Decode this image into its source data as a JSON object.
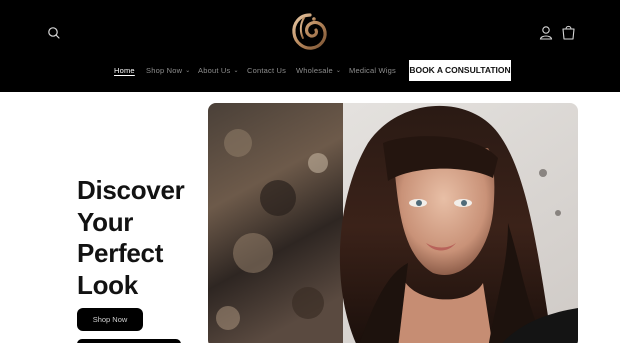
{
  "header": {
    "icons": {
      "search": "search-icon",
      "logo": "brand-logo-icon",
      "account": "account-icon",
      "cart": "cart-icon"
    },
    "nav": [
      {
        "label": "Home",
        "active": true,
        "dropdown": false
      },
      {
        "label": "Shop Now",
        "active": false,
        "dropdown": true
      },
      {
        "label": "About Us",
        "active": false,
        "dropdown": true
      },
      {
        "label": "Contact Us",
        "active": false,
        "dropdown": false
      },
      {
        "label": "Wholesale",
        "active": false,
        "dropdown": true
      },
      {
        "label": "Medical Wigs",
        "active": false,
        "dropdown": false
      }
    ],
    "cta_label": "BOOK A CONSULTATION"
  },
  "hero": {
    "title_lines": [
      "Discover",
      "Your",
      "Perfect",
      "Look"
    ],
    "primary_button_label": "Shop Now"
  },
  "colors": {
    "header_bg": "#000000",
    "page_bg": "#ffffff",
    "logo_gold": "#c9a27a",
    "text_dark": "#121212"
  }
}
